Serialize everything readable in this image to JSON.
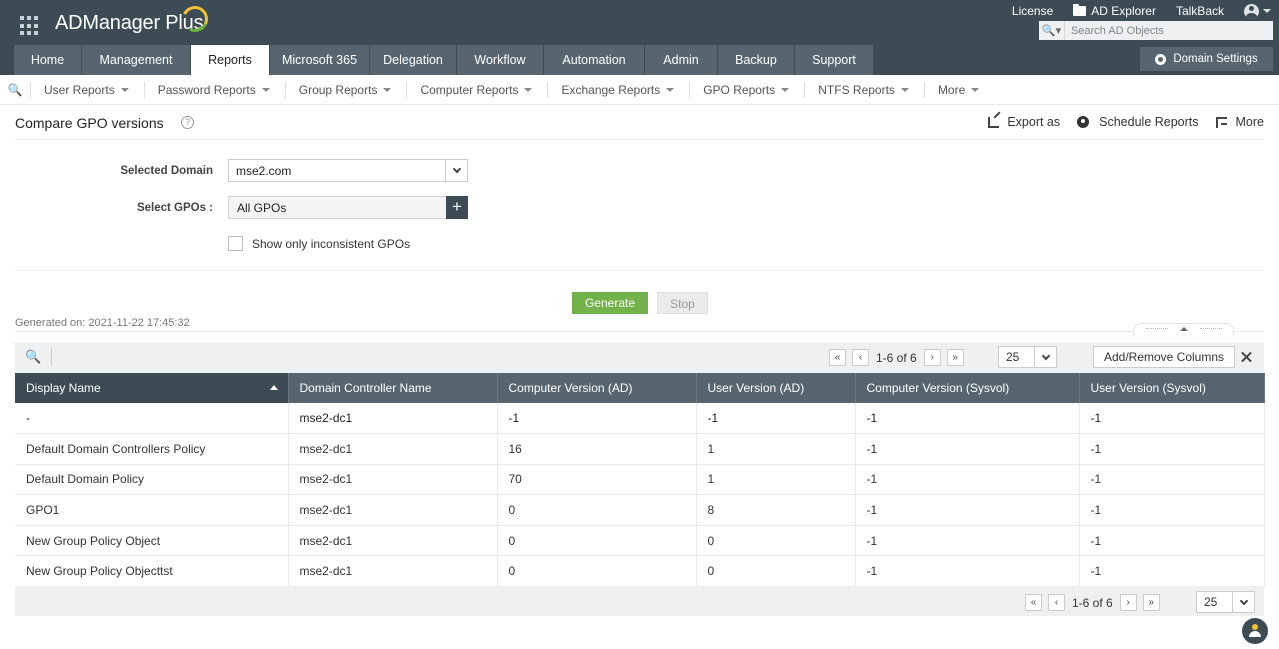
{
  "app": {
    "name": "ADManager Plus"
  },
  "top_links": {
    "license": "License",
    "ad_explorer": "AD Explorer",
    "talkback": "TalkBack"
  },
  "search": {
    "placeholder": "Search AD Objects"
  },
  "nav": {
    "tabs": [
      {
        "label": "Home",
        "active": false
      },
      {
        "label": "Management",
        "active": false
      },
      {
        "label": "Reports",
        "active": true
      },
      {
        "label": "Microsoft 365",
        "active": false
      },
      {
        "label": "Delegation",
        "active": false
      },
      {
        "label": "Workflow",
        "active": false
      },
      {
        "label": "Automation",
        "active": false
      },
      {
        "label": "Admin",
        "active": false
      },
      {
        "label": "Backup",
        "active": false
      },
      {
        "label": "Support",
        "active": false
      }
    ],
    "domain_settings": "Domain Settings"
  },
  "subnav": {
    "items": [
      "User Reports",
      "Password Reports",
      "Group Reports",
      "Computer Reports",
      "Exchange Reports",
      "GPO Reports",
      "NTFS Reports",
      "More"
    ]
  },
  "page": {
    "title": "Compare GPO versions",
    "actions": {
      "export": "Export as",
      "schedule": "Schedule Reports",
      "more": "More"
    }
  },
  "form": {
    "domain_label": "Selected Domain",
    "domain_value": "mse2.com",
    "gpos_label": "Select GPOs :",
    "gpos_value": "All GPOs",
    "inconsistent_label": "Show only inconsistent GPOs",
    "inconsistent_checked": false,
    "generate": "Generate",
    "stop": "Stop",
    "generated_on": "Generated on: 2021-11-22 17:45:32"
  },
  "table": {
    "pager_text": "1-6 of 6",
    "per_page": "25",
    "add_remove": "Add/Remove Columns",
    "columns": [
      "Display Name",
      "Domain Controller Name",
      "Computer Version (AD)",
      "User Version (AD)",
      "Computer Version (Sysvol)",
      "User Version (Sysvol)"
    ],
    "rows": [
      [
        "-",
        "mse2-dc1",
        "-1",
        "-1",
        "-1",
        "-1"
      ],
      [
        "Default Domain Controllers Policy",
        "mse2-dc1",
        "16",
        "1",
        "-1",
        "-1"
      ],
      [
        "Default Domain Policy",
        "mse2-dc1",
        "70",
        "1",
        "-1",
        "-1"
      ],
      [
        "GPO1",
        "mse2-dc1",
        "0",
        "8",
        "-1",
        "-1"
      ],
      [
        "New Group Policy Object",
        "mse2-dc1",
        "0",
        "0",
        "-1",
        "-1"
      ],
      [
        "New Group Policy Objecttst",
        "mse2-dc1",
        "0",
        "0",
        "-1",
        "-1"
      ]
    ]
  },
  "colors": {
    "header_bg": "#3d4b55",
    "tab_bg": "#56656f",
    "generate_green": "#71b34a"
  }
}
